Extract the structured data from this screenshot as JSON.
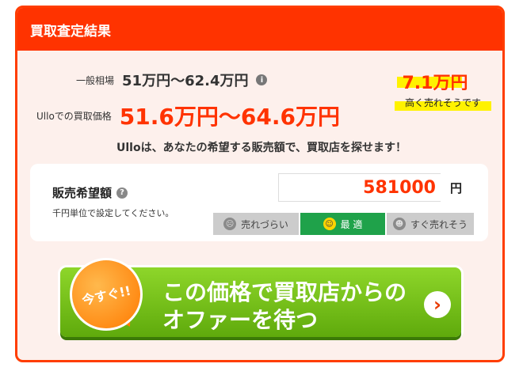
{
  "header": {
    "title": "買取査定結果"
  },
  "summary": {
    "market_label": "一般相場",
    "market_value": "51万円〜62.4万円",
    "buy_label": "Ulloでの買取価格",
    "buy_value": "51.6万円〜64.6万円"
  },
  "highlight": {
    "value": "7.1万円",
    "subtitle": "高く売れそうです"
  },
  "tagline": "Ulloは、あなたの希望する販売額で、買取店を探せます！",
  "price_panel": {
    "title": "販売希望額",
    "note": "千円単位で設定してください。",
    "input_value": "581000",
    "unit": "円",
    "segments": [
      {
        "label": "売れづらい"
      },
      {
        "label": "最 適"
      },
      {
        "label": "すぐ売れそう"
      }
    ]
  },
  "cta": {
    "badge": "今すぐ!!",
    "line1": "この価格で買取店からの",
    "line2": "オファーを待つ",
    "arrow": "›"
  },
  "colors": {
    "accent": "#ff3300",
    "cta_green": "#6cbd12",
    "optimal": "#1fa24a",
    "highlight": "#fff200"
  }
}
